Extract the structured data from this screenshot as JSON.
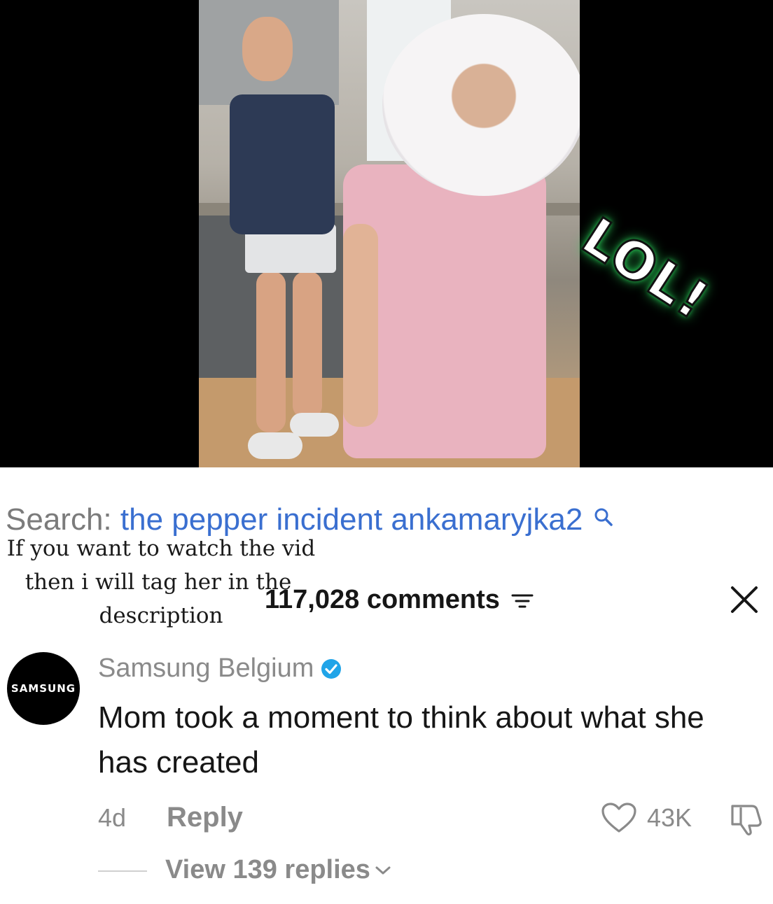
{
  "video": {
    "sticker_text": "LOL!"
  },
  "search": {
    "prefix": "Search:",
    "term": "the pepper incident ankamaryjka2",
    "icon": "search-icon"
  },
  "overlay": {
    "line1": "If you want to watch the vid",
    "line2": "then i will tag her in the",
    "line3": "description"
  },
  "comments_header": {
    "count_label": "117,028 comments",
    "sort_icon": "sort-icon",
    "close_icon": "close-icon"
  },
  "comment": {
    "avatar_text": "SAMSUNG",
    "username": "Samsung Belgium",
    "verified": true,
    "text": "Mom took a moment to think about what she has created",
    "time": "4d",
    "reply_label": "Reply",
    "likes": "43K",
    "view_replies": "View 139 replies"
  },
  "colors": {
    "search_term": "#3a6fd0",
    "verified_badge": "#20a4e8",
    "sticker_glow": "#2ad35a",
    "muted_text": "#8a8a8a"
  }
}
